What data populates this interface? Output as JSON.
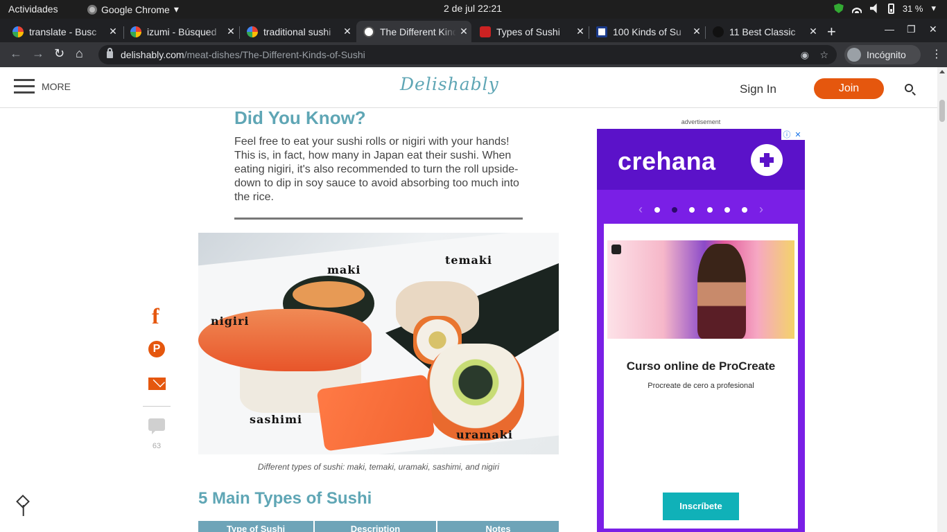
{
  "system": {
    "activities": "Actividades",
    "app_name": "Google Chrome",
    "clock": "2 de jul  22:21",
    "battery": "31 %"
  },
  "tabs": [
    {
      "label": "translate - Busc",
      "favicon": "google-icon"
    },
    {
      "label": "izumi - Búsqued",
      "favicon": "google-icon"
    },
    {
      "label": "traditional sushi",
      "favicon": "google-icon"
    },
    {
      "label": "The Different Kinds",
      "favicon": "delishably-icon",
      "active": true
    },
    {
      "label": "Types of Sushi",
      "favicon": "site-icon"
    },
    {
      "label": "100 Kinds of Su",
      "favicon": "site-icon"
    },
    {
      "label": "11 Best Classic",
      "favicon": "site-icon"
    }
  ],
  "toolbar": {
    "url_domain": "delishably.com",
    "url_path": "/meat-dishes/The-Different-Kinds-of-Sushi",
    "incognito_label": "Incógnito"
  },
  "site": {
    "menu_label": "MORE",
    "logo": "Delishably",
    "signin": "Sign In",
    "join": "Join"
  },
  "article": {
    "dyk_title": "Did You Know?",
    "dyk_body": "Feel free to eat your sushi rolls or nigiri with your hands! This is, in fact, how many in Japan eat their sushi. When eating nigiri, it's also recommended to turn the roll upside-down to dip in soy sauce to avoid absorbing too much into the rice.",
    "photo_labels": {
      "maki": "maki",
      "temaki": "temaki",
      "nigiri": "nigiri",
      "sashimi": "sashimi",
      "uramaki": "uramaki"
    },
    "caption": "Different types of sushi: maki, temaki, uramaki, sashimi, and nigiri",
    "section_title": "5 Main Types of Sushi",
    "table_headers": [
      "Type of Sushi",
      "Description",
      "Notes"
    ]
  },
  "share": {
    "comment_count": "63"
  },
  "ad": {
    "label": "advertisement",
    "brand": "crehana",
    "title": "Curso online de ProCreate",
    "subtitle": "Procreate de cero a profesional",
    "cta": "Inscríbete"
  },
  "colors": {
    "accent": "#5fa6b5",
    "brand_orange": "#e5570e",
    "ad_purple": "#7a1fe6"
  }
}
